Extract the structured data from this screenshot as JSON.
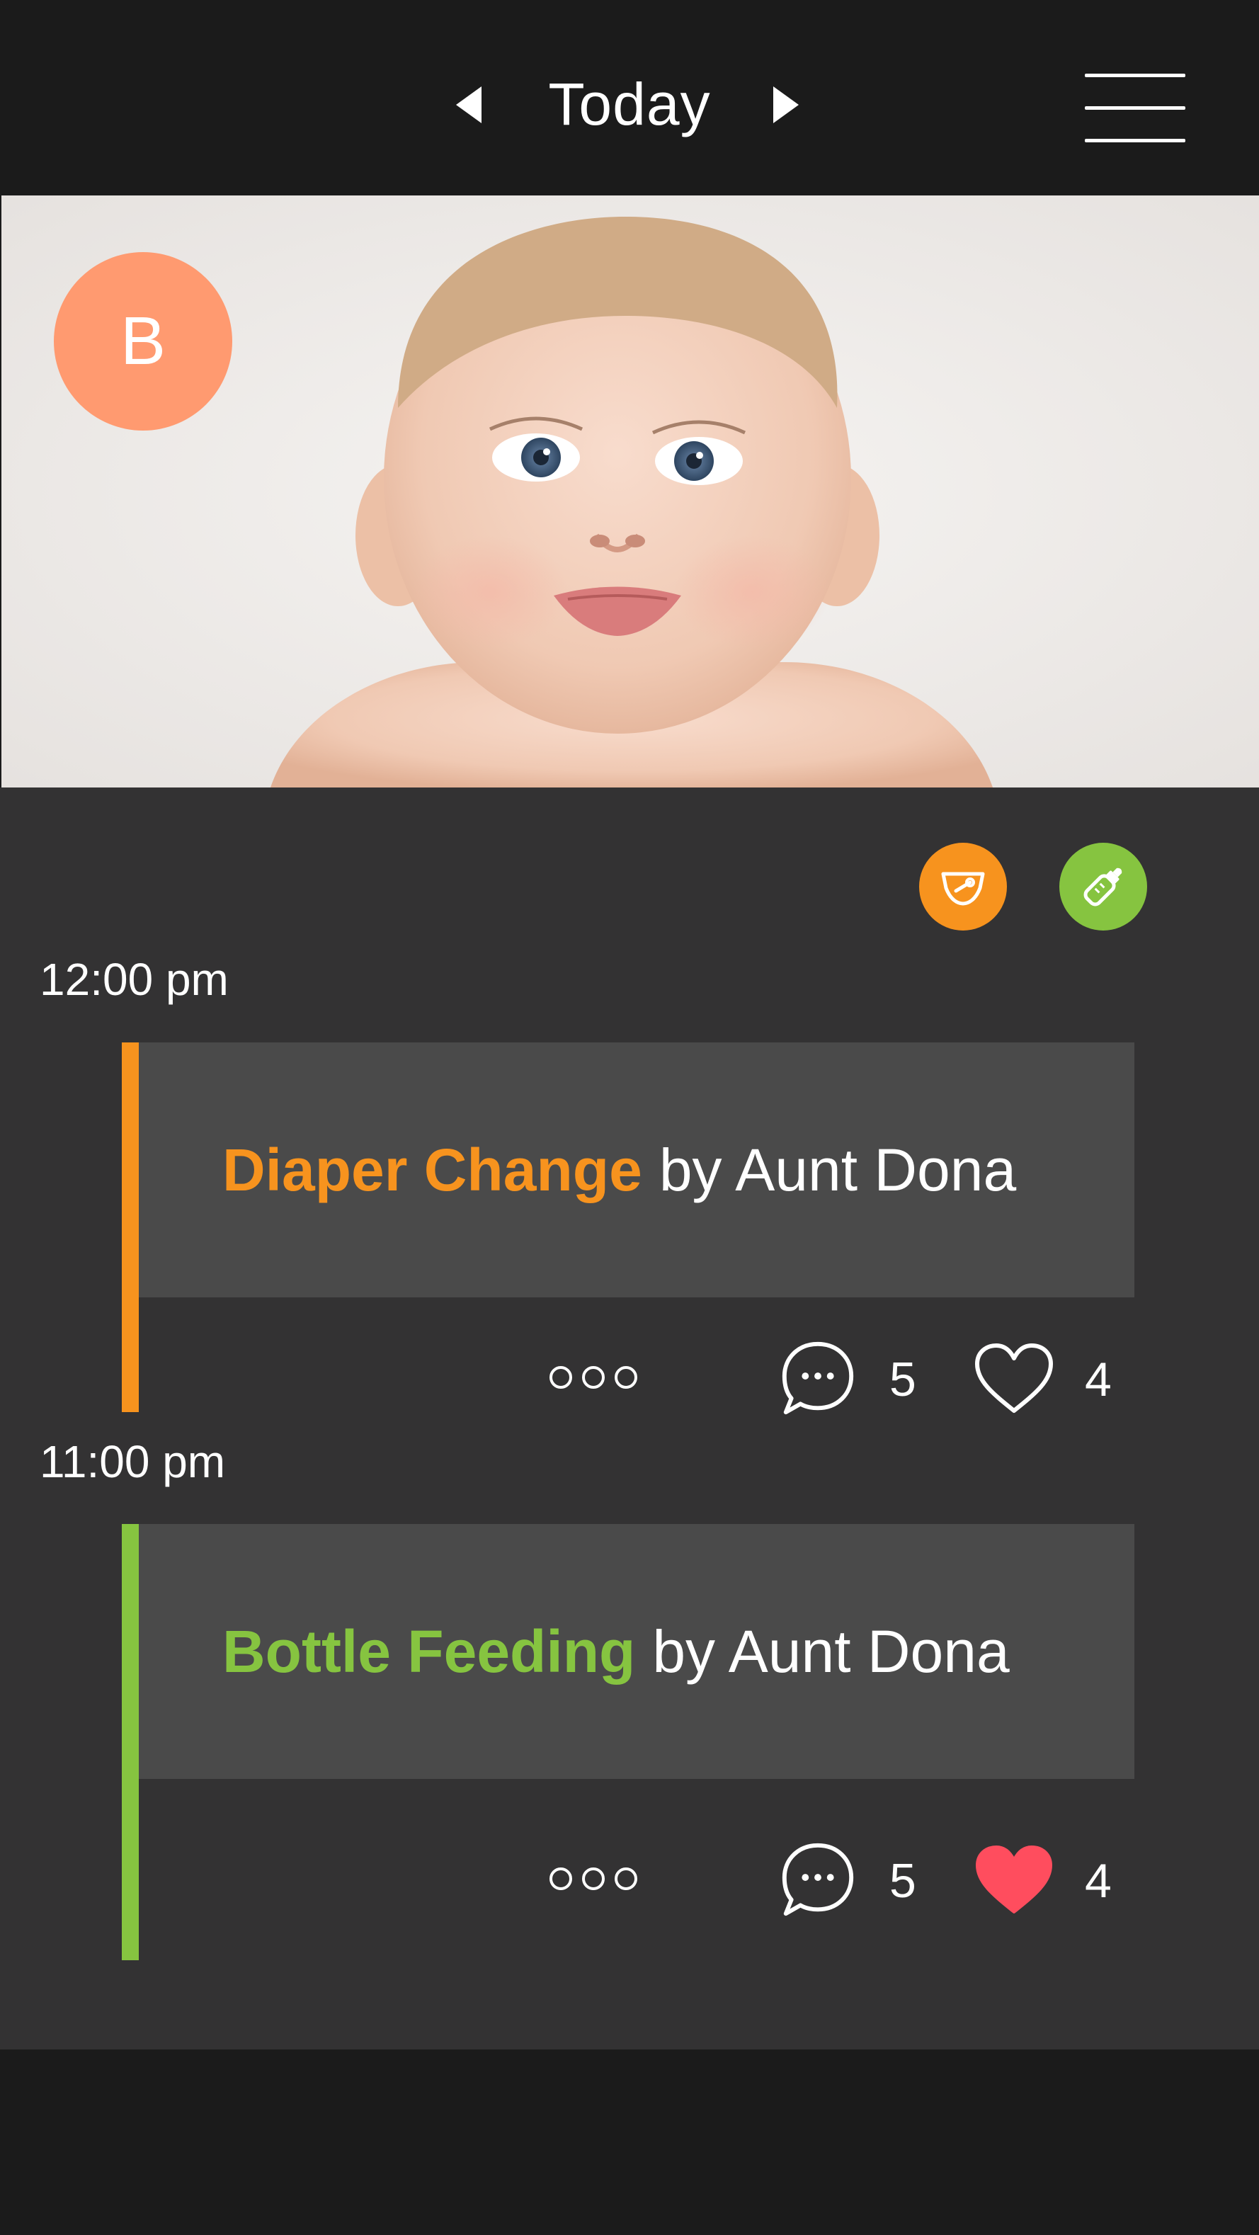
{
  "header": {
    "title": "Today",
    "prev_icon": "chevron-left-icon",
    "next_icon": "chevron-right-icon",
    "menu_icon": "hamburger-menu-icon"
  },
  "profile": {
    "avatar_initial": "B",
    "avatar_color": "#ff9a70"
  },
  "filters": [
    {
      "icon": "diaper-icon",
      "color": "#f7931e"
    },
    {
      "icon": "bottle-icon",
      "color": "#86c440"
    }
  ],
  "timeline": [
    {
      "time": "12:00 pm",
      "type": "Diaper Change",
      "by": "by Aunt Dona",
      "accent": "#f7931e",
      "comments": "5",
      "likes": "4",
      "liked": false
    },
    {
      "time": "11:00 pm",
      "type": "Bottle Feeding",
      "by": "by Aunt Dona",
      "accent": "#86c440",
      "comments": "5",
      "likes": "4",
      "liked": true
    }
  ]
}
